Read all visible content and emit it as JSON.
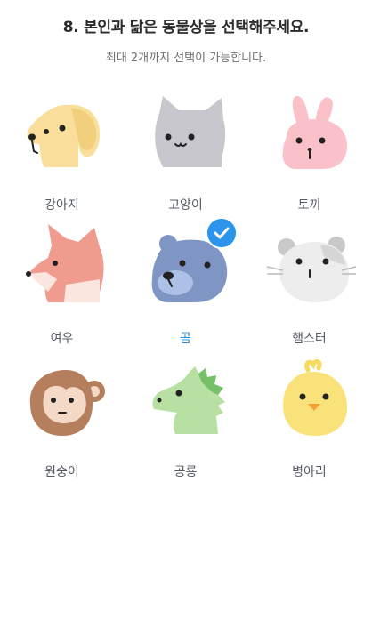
{
  "question": {
    "title": "8. 본인과 닮은 동물상을 선택해주세요.",
    "subtitle": "최대 2개까지 선택이 가능합니다."
  },
  "options": [
    {
      "label": "강아지",
      "icon": "dog-icon",
      "selected": false
    },
    {
      "label": "고양이",
      "icon": "cat-icon",
      "selected": false
    },
    {
      "label": "토끼",
      "icon": "rabbit-icon",
      "selected": false
    },
    {
      "label": "여우",
      "icon": "fox-icon",
      "selected": false
    },
    {
      "label": "곰",
      "icon": "bear-icon",
      "selected": true
    },
    {
      "label": "햄스터",
      "icon": "hamster-icon",
      "selected": false
    },
    {
      "label": "원숭이",
      "icon": "monkey-icon",
      "selected": false
    },
    {
      "label": "공룡",
      "icon": "dinosaur-icon",
      "selected": false
    },
    {
      "label": "병아리",
      "icon": "chick-icon",
      "selected": false
    }
  ],
  "colors": {
    "selected_label": "#1d8fe1",
    "check_badge": "#2a95ea"
  }
}
